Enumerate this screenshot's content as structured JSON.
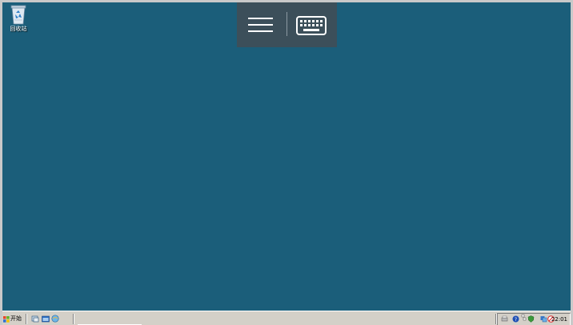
{
  "desktop": {
    "background_color": "#1b5e7a",
    "icons": [
      {
        "label": "回收站",
        "icon": "recycle-bin-icon"
      }
    ]
  },
  "remote_toolbar": {
    "background_color": "#3c4f5a",
    "menu_icon": "hamburger-menu-icon",
    "keyboard_icon": "keyboard-icon"
  },
  "taskbar": {
    "start_label": "开始",
    "quick_launch": [
      "show-desktop-icon",
      "explorer-icon",
      "browser-icon"
    ],
    "tray_icons": [
      "printer-icon",
      "help-icon",
      "network-icon",
      "shield-icon",
      "volume-icon",
      "security-alert-icon"
    ],
    "clock": "22:01"
  }
}
